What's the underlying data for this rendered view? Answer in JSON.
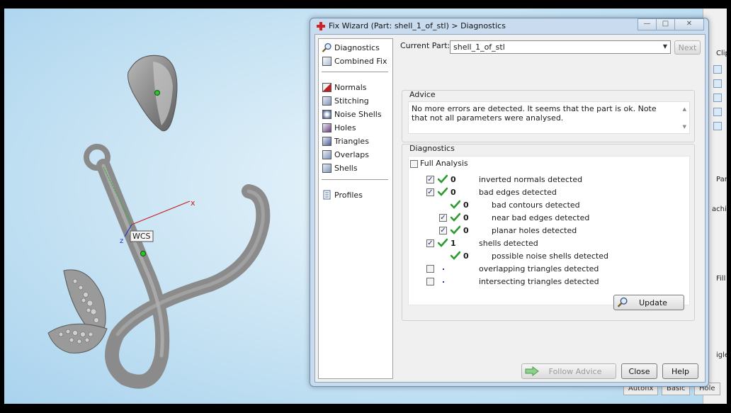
{
  "dialog": {
    "title": "Fix Wizard (Part: shell_1_of_stl) > Diagnostics",
    "window_buttons": {
      "minimize": "—",
      "maximize": "□",
      "close": "✕"
    }
  },
  "nav": {
    "items": [
      {
        "label": "Diagnostics",
        "icon": "magnifier-icon"
      },
      {
        "label": "Combined Fix",
        "icon": "combined-fix-icon"
      },
      {
        "label": "Normals",
        "icon": "normals-cube-icon"
      },
      {
        "label": "Stitching",
        "icon": "stitching-cube-icon"
      },
      {
        "label": "Noise Shells",
        "icon": "noise-shells-icon"
      },
      {
        "label": "Holes",
        "icon": "holes-cube-icon"
      },
      {
        "label": "Triangles",
        "icon": "triangles-cube-icon"
      },
      {
        "label": "Overlaps",
        "icon": "overlaps-cube-icon"
      },
      {
        "label": "Shells",
        "icon": "shells-cube-icon"
      },
      {
        "label": "Profiles",
        "icon": "profiles-doc-icon"
      }
    ]
  },
  "part": {
    "label": "Current Part:",
    "value": "shell_1_of_stl",
    "next_label": "Next"
  },
  "advice": {
    "title": "Advice",
    "text": "No more errors are detected. It seems that the part is ok. Note that not all parameters were analysed."
  },
  "diagnostics": {
    "title": "Diagnostics",
    "full_analysis_label": "Full Analysis",
    "rows": [
      {
        "checked": true,
        "status": "ok",
        "count": "0",
        "text": "inverted normals detected",
        "indent": 0
      },
      {
        "checked": true,
        "status": "ok",
        "count": "0",
        "text": "bad edges detected",
        "indent": 0
      },
      {
        "checked": null,
        "status": "ok",
        "count": "0",
        "text": "bad contours detected",
        "indent": 1
      },
      {
        "checked": true,
        "status": "ok",
        "count": "0",
        "text": "near bad edges detected",
        "indent": 1
      },
      {
        "checked": true,
        "status": "ok",
        "count": "0",
        "text": "planar holes detected",
        "indent": 1
      },
      {
        "checked": true,
        "status": "ok",
        "count": "1",
        "text": "shells detected",
        "indent": 0
      },
      {
        "checked": null,
        "status": "ok",
        "count": "0",
        "text": "possible noise shells detected",
        "indent": 1
      },
      {
        "checked": false,
        "status": "unknown",
        "count": "",
        "text": "overlapping triangles detected",
        "indent": 0
      },
      {
        "checked": false,
        "status": "unknown",
        "count": "",
        "text": "intersecting triangles detected",
        "indent": 0
      }
    ],
    "update_label": "Update"
  },
  "footer": {
    "follow_advice_label": "Follow Advice",
    "close_label": "Close",
    "help_label": "Help"
  },
  "viewport": {
    "wcs_label": "WCS",
    "x_axis_label": "x",
    "z_axis_label": "z"
  },
  "background_panel": {
    "fragments": [
      "Clip",
      "Par",
      "achi",
      "Fill",
      "igle"
    ],
    "tabs": [
      "Autofix",
      "Basic",
      "Hole"
    ]
  },
  "colors": {
    "ok_tick": "#2f9a2f",
    "axis_x": "#c62020",
    "axis_y": "#3fae3f",
    "axis_z": "#2036c6"
  }
}
